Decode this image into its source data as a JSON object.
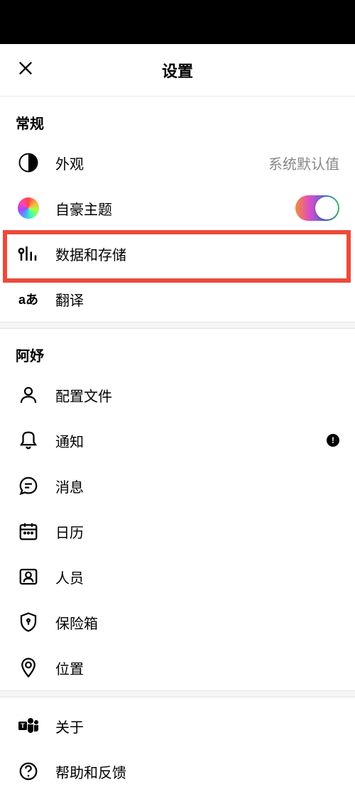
{
  "header": {
    "title": "设置"
  },
  "sections": {
    "general": {
      "title": "常规",
      "appearance": {
        "label": "外观",
        "value": "系统默认值"
      },
      "pride_theme": {
        "label": "自豪主题"
      },
      "data_storage": {
        "label": "数据和存储"
      },
      "translate": {
        "label": "翻译"
      }
    },
    "user": {
      "title": "阿妤",
      "profile": {
        "label": "配置文件"
      },
      "notifications": {
        "label": "通知"
      },
      "messages": {
        "label": "消息"
      },
      "calendar": {
        "label": "日历"
      },
      "people": {
        "label": "人员"
      },
      "safe": {
        "label": "保险箱"
      },
      "location": {
        "label": "位置"
      }
    },
    "footer": {
      "about": {
        "label": "关于"
      },
      "help": {
        "label": "帮助和反馈"
      }
    }
  },
  "badge_text": "!"
}
